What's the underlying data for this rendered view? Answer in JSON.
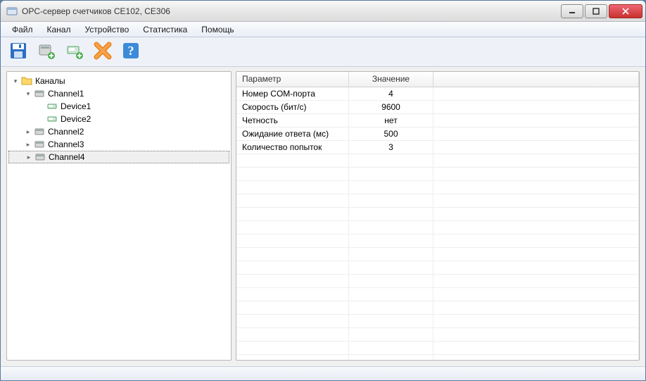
{
  "window": {
    "title": "OPC-сервер счетчиков CE102, CE306"
  },
  "menu": {
    "items": [
      "Файл",
      "Канал",
      "Устройство",
      "Статистика",
      "Помощь"
    ]
  },
  "toolbar": {
    "save": "save-icon",
    "add_channel": "add-channel-icon",
    "add_device": "add-device-icon",
    "delete": "delete-icon",
    "help": "help-icon"
  },
  "tree": {
    "root": {
      "label": "Каналы",
      "expanded": true
    },
    "channels": [
      {
        "label": "Channel1",
        "expanded": true,
        "devices": [
          {
            "label": "Device1"
          },
          {
            "label": "Device2"
          }
        ]
      },
      {
        "label": "Channel2",
        "expanded": false,
        "devices": []
      },
      {
        "label": "Channel3",
        "expanded": false,
        "devices": []
      },
      {
        "label": "Channel4",
        "expanded": false,
        "devices": [],
        "selected": true
      }
    ]
  },
  "grid": {
    "headers": {
      "param": "Параметр",
      "value": "Значение"
    },
    "rows": [
      {
        "param": "Номер COM-порта",
        "value": "4"
      },
      {
        "param": "Скорость (бит/с)",
        "value": "9600"
      },
      {
        "param": "Четность",
        "value": "нет"
      },
      {
        "param": "Ожидание ответа (мс)",
        "value": "500"
      },
      {
        "param": "Количество попыток",
        "value": "3"
      }
    ],
    "blank_rows": 16
  }
}
